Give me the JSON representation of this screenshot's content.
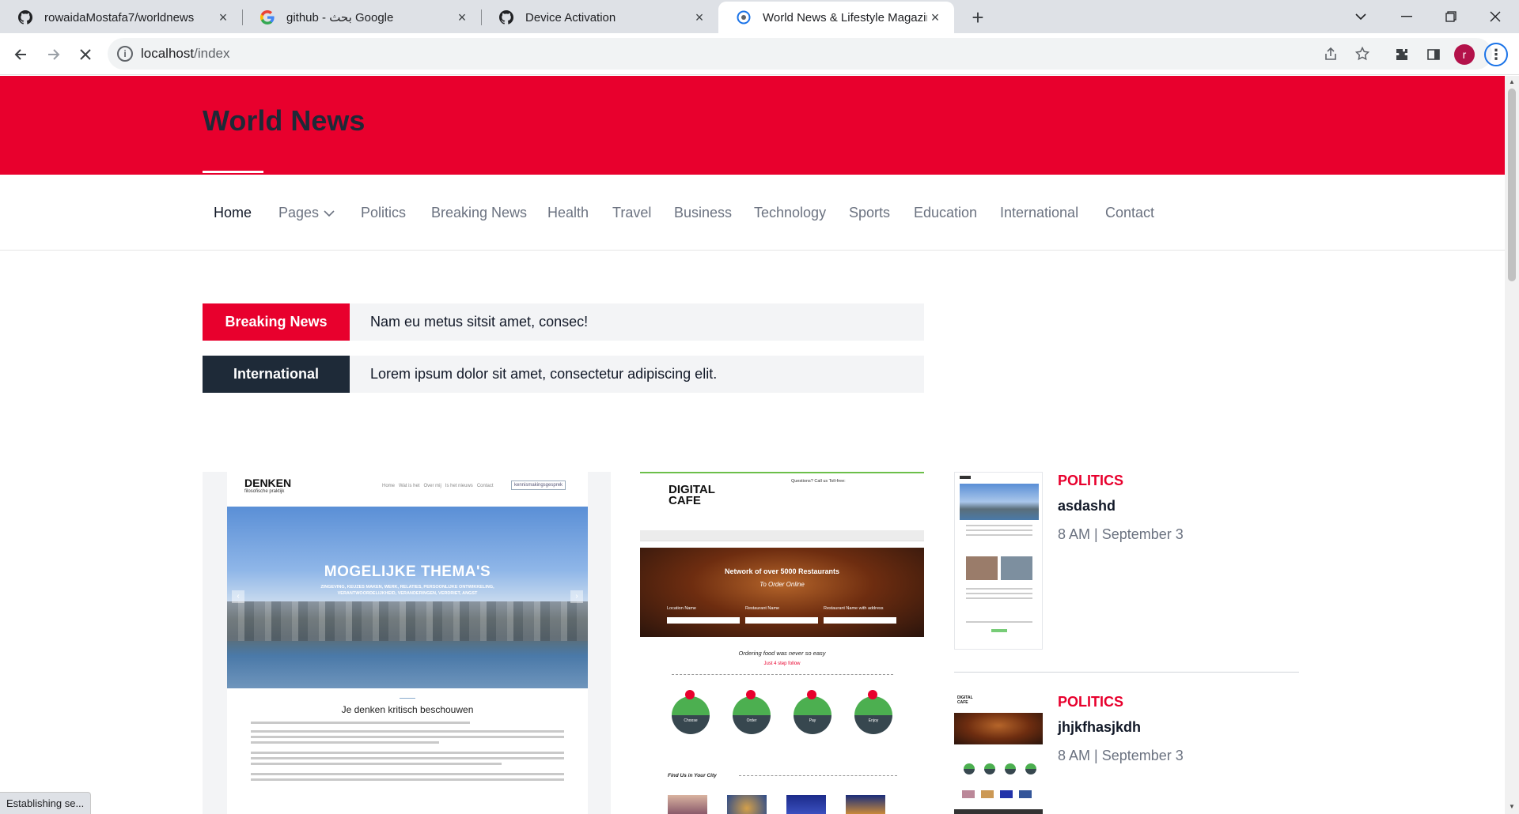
{
  "browser": {
    "tabs": [
      {
        "title": "rowaidaMostafa7/worldnews",
        "icon": "github-icon"
      },
      {
        "title": "github - بحث Google",
        "icon": "google-icon"
      },
      {
        "title": "Device Activation",
        "icon": "github-icon"
      },
      {
        "title": "World News & Lifestyle Magazin",
        "icon": "site-icon"
      }
    ],
    "url_host": "localhost",
    "url_path": "/index",
    "profile_initial": "r",
    "status_text": "Establishing se..."
  },
  "site": {
    "logo": "World News",
    "nav": [
      {
        "label": "Home",
        "active": true
      },
      {
        "label": "Pages",
        "dropdown": true
      },
      {
        "label": "Politics"
      },
      {
        "label": "Breaking News"
      },
      {
        "label": "Health"
      },
      {
        "label": "Travel"
      },
      {
        "label": "Business"
      },
      {
        "label": "Technology"
      },
      {
        "label": "Sports"
      },
      {
        "label": "Education"
      },
      {
        "label": "International"
      },
      {
        "label": "Contact"
      }
    ],
    "tickers": [
      {
        "label": "Breaking News",
        "text": "Nam eu metus sitsit amet, consec!",
        "color": "#e8002d"
      },
      {
        "label": "International",
        "text": "Lorem ipsum dolor sit amet, consectetur adipiscing elit.",
        "color": "#1e2a38"
      }
    ],
    "card1": {
      "brand": "DENKEN",
      "brand_sub": "filosofische praktijk",
      "nav": "Home   Wat is het   Over mij   Is het nieuws   Contact",
      "nav_btn": "kennismakingsgesprek",
      "hero_title": "MOGELIJKE THEMA'S",
      "hero_sub": "ZINGEVING, KEUZES MAKEN, WERK, RELATIES, PERSOONLIJKE ONTWIKKELING, VERANTWOORDELIJKHEID, VERANDERINGEN, VERDRIET, ANGST",
      "section_title": "Je denken kritisch beschouwen"
    },
    "card2": {
      "brand": "DIGITAL CAFE",
      "top_note": "Questions? Call us Toll-free:",
      "hero_title": "Network of over 5000 Restaurants",
      "hero_sub": "To Order Online",
      "fields": [
        "Location Name",
        "Restaurant Name",
        "Restaurant Name with address"
      ],
      "tagline": "Ordering food was never so easy",
      "tagline2": "Just 4 step follow",
      "steps": [
        "Choose",
        "Order",
        "Pay",
        "Enjoy"
      ],
      "find": "Find Us in Your City"
    },
    "posts": [
      {
        "category": "POLITICS",
        "title": "asdashd",
        "meta": "8 AM | September 3"
      },
      {
        "category": "POLITICS",
        "title": "jhjkfhasjkdh",
        "meta": "8 AM | September 3"
      }
    ]
  }
}
